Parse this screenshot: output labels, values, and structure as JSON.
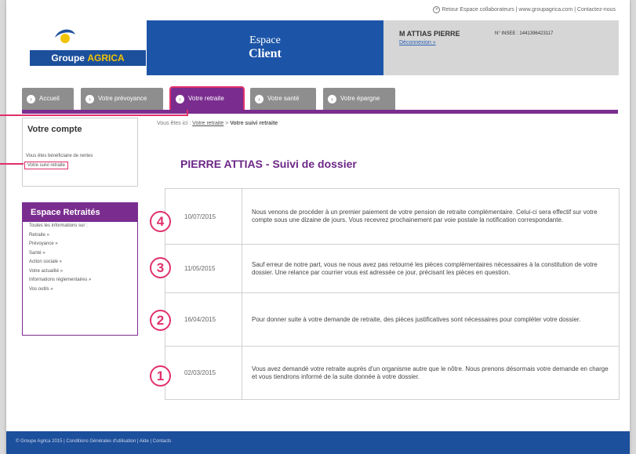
{
  "toplinks": {
    "bullet": "»",
    "text": "Retour Espace collaborateurs | www.groupagrica.com | Contactez-nous"
  },
  "logo": {
    "part1": "Groupe ",
    "part2": "AGRICA"
  },
  "header": {
    "line1": "Espace",
    "line2": "Client"
  },
  "user": {
    "name": "M ATTIAS PIERRE",
    "logout": "Déconnexion »",
    "insee": "N° INSEE : 1441396423117"
  },
  "tabs": [
    {
      "label": "Accueil"
    },
    {
      "label": "Votre prévoyance"
    },
    {
      "label": "Votre retraite"
    },
    {
      "label": "Votre santé"
    },
    {
      "label": "Votre épargne"
    }
  ],
  "account": {
    "heading": "Votre compte",
    "link1": "Vous êtes bénéficiaire de rentes",
    "link2": "Votre suivi retraite"
  },
  "retraites": {
    "heading": "Espace Retraités",
    "items": [
      "Toutes les informations sur :",
      "Retraite »",
      "Prévoyance »",
      "Santé »",
      "Action sociale »",
      "Votre actualité »",
      "Informations réglementaires »",
      "Vos outils »"
    ]
  },
  "breadcrumb": {
    "prefix": "Vous êtes ici :",
    "link": "Votre retraite",
    "sep": ">",
    "current": "Votre suivi retraite"
  },
  "page_title": "PIERRE ATTIAS - Suivi de dossier",
  "timeline": [
    {
      "num": "4",
      "date": "10/07/2015",
      "text": "Nous venons de procéder à un premier paiement de votre pension de retraite complémentaire. Celui-ci sera effectif sur votre compte sous une dizaine de jours. Vous recevrez prochainement par voie postale la notification correspondante."
    },
    {
      "num": "3",
      "date": "11/05/2015",
      "text": "Sauf erreur de notre part, vous ne nous avez pas retourné les pièces complémentaires nécessaires à la constitution de votre dossier. Une relance par courrier vous est adressée ce jour, précisant les pièces en question."
    },
    {
      "num": "2",
      "date": "16/04/2015",
      "text": "Pour donner suite à votre demande de retraite, des pièces justificatives sont nécessaires pour compléter votre dossier."
    },
    {
      "num": "1",
      "date": "02/03/2015",
      "text": "Vous avez demandé votre retraite auprès d'un organisme autre que le nôtre. Nous prenons désormais votre demande en charge et vous tiendrons informé de la suite donnée à votre dossier."
    }
  ],
  "footer": "© Groupe Agrica 2015 | Conditions Générales d'utilisation | Aide | Contacts",
  "colors": {
    "brand_blue": "#1c55a8",
    "purple": "#7a2d8f",
    "highlight_pink": "#e0306c"
  }
}
